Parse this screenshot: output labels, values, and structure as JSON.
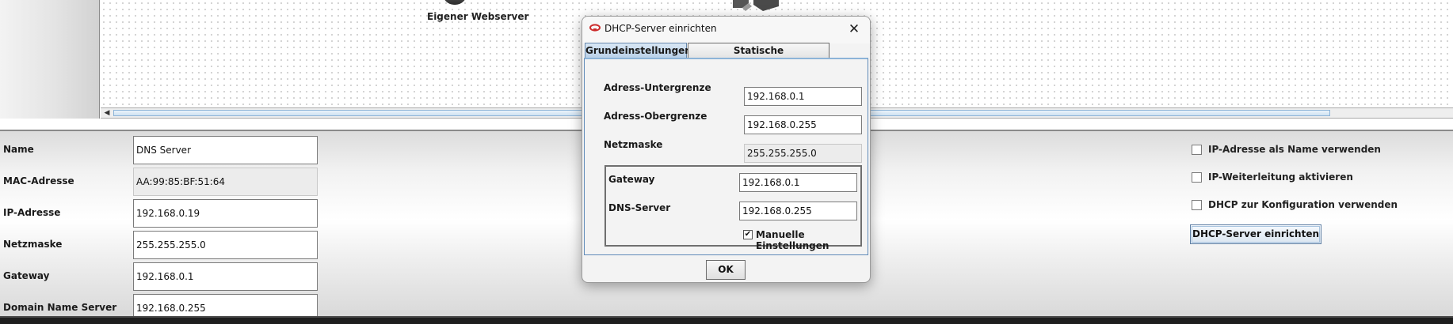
{
  "workspace": {
    "node_label": "Eigener Webserver"
  },
  "properties": {
    "fields": [
      {
        "label": "Name",
        "value": "DNS Server"
      },
      {
        "label": "MAC-Adresse",
        "value": "AA:99:85:BF:51:64"
      },
      {
        "label": "IP-Adresse",
        "value": "192.168.0.19"
      },
      {
        "label": "Netzmaske",
        "value": "255.255.255.0"
      },
      {
        "label": "Gateway",
        "value": "192.168.0.1"
      },
      {
        "label": "Domain Name Server",
        "value": "192.168.0.255"
      }
    ],
    "options": [
      {
        "label": "IP-Adresse als Name verwenden",
        "checked": false
      },
      {
        "label": "IP-Weiterleitung aktivieren",
        "checked": false
      },
      {
        "label": "DHCP zur Konfiguration verwenden",
        "checked": false
      }
    ],
    "dhcp_button_label": "DHCP-Server einrichten"
  },
  "dialog": {
    "title": "DHCP-Server einrichten",
    "close_symbol": "✕",
    "tabs": [
      {
        "label": "Grundeinstellungen",
        "active": true
      },
      {
        "label": "Statische Adresszuweisung",
        "active": false
      }
    ],
    "fields": {
      "lower": {
        "label": "Adress-Untergrenze",
        "value": "192.168.0.1"
      },
      "upper": {
        "label": "Adress-Obergrenze",
        "value": "192.168.0.255"
      },
      "netmask": {
        "label": "Netzmaske",
        "value": "255.255.255.0"
      },
      "gateway": {
        "label": "Gateway",
        "value": "192.168.0.1"
      },
      "dns": {
        "label": "DNS-Server",
        "value": "192.168.0.255"
      }
    },
    "manual": {
      "label": "Manuelle Einstellungen",
      "checked": true,
      "check_symbol": "✔"
    },
    "ok_label": "OK"
  },
  "colors": {
    "accent_blue": "#8db4d8",
    "active_tab": "#b8d0e8",
    "title_icon": "#cc2b2b"
  }
}
